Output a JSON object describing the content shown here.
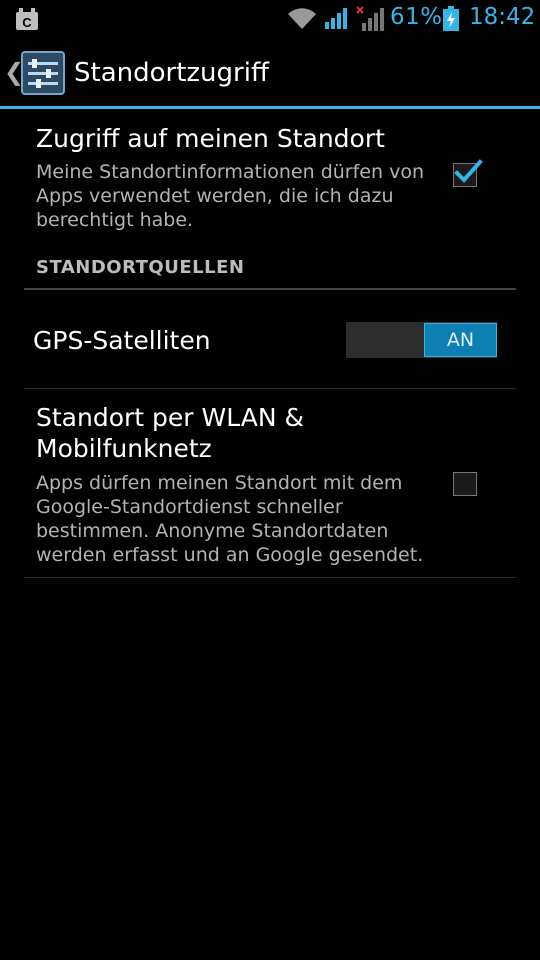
{
  "status_bar": {
    "battery_percent": "61%",
    "time": "18:42",
    "accent": "#33b5e5",
    "icons": [
      "notification-icon",
      "wifi-icon",
      "signal-icon",
      "no-signal-icon",
      "battery-charging-icon"
    ]
  },
  "action_bar": {
    "title": "Standortzugriff",
    "icon": "settings-sliders-icon",
    "back_glyph": "❮"
  },
  "prefs": {
    "location_access": {
      "title": "Zugriff auf meinen Standort",
      "summary_lines": [
        "Meine Standortinformationen dürfen von",
        "Apps verwendet werden, die ich dazu",
        "berechtigt habe."
      ],
      "checked": true
    },
    "category": "STANDORTQUELLEN",
    "gps": {
      "title": "GPS-Satelliten",
      "switch_label": "AN",
      "on": true
    },
    "wlan": {
      "title_lines": [
        "Standort per WLAN &",
        "Mobilfunknetz"
      ],
      "summary_lines": [
        "Apps dürfen meinen Standort mit dem",
        "Google-Standortdienst schneller",
        "bestimmen. Anonyme Standortdaten",
        "werden erfasst und an Google gesendet."
      ],
      "checked": false
    }
  }
}
